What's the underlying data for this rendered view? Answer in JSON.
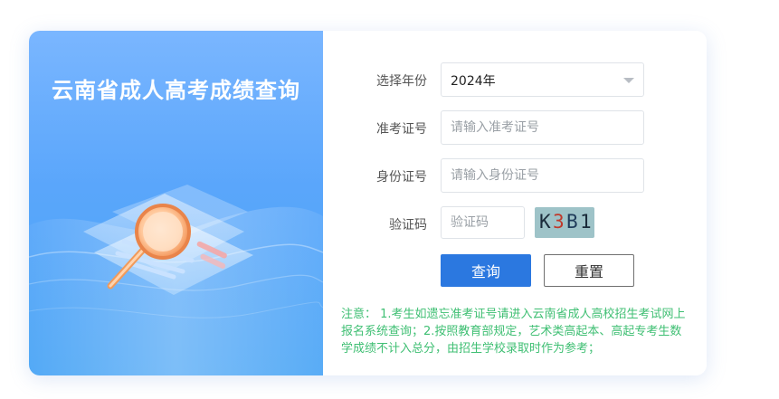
{
  "title": "云南省成人高考成绩查询",
  "form": {
    "year_label": "选择年份",
    "year_value": "2024年",
    "admission_label": "准考证号",
    "admission_placeholder": "请输入准考证号",
    "id_label": "身份证号",
    "id_placeholder": "请输入身份证号",
    "captcha_label": "验证码",
    "captcha_placeholder": "验证码",
    "captcha_chars": [
      "K",
      "3",
      "B",
      "1"
    ],
    "query_button": "查询",
    "reset_button": "重置"
  },
  "notice": "注意：  1.考生如遗忘准考证号请进入云南省成人高校招生考试网上报名系统查询；2.按照教育部规定，艺术类高起本、高起专考生数学成绩不计入总分，由招生学校录取时作为参考；",
  "colors": {
    "left_panel": "#5aa6fb",
    "primary_button": "#2b78e0",
    "notice_text": "#3fbf73"
  }
}
